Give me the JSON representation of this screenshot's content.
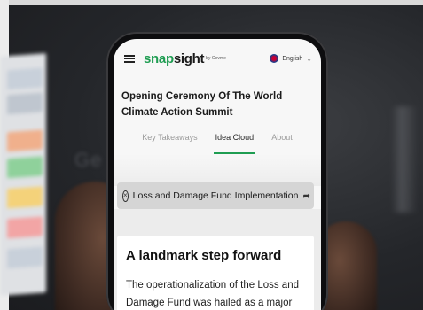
{
  "header": {
    "logo_primary": "snap",
    "logo_secondary": "sight",
    "logo_tag": "by Gevme",
    "language": "English",
    "icons": {
      "menu": "hamburger-icon",
      "flag": "flag-icon",
      "chevron": "chevron-down-icon"
    }
  },
  "session": {
    "title": "Opening Ceremony Of The World Climate Action Summit"
  },
  "tabs": [
    {
      "label": "Key Takeaways",
      "active": false
    },
    {
      "label": "Idea Cloud",
      "active": true
    },
    {
      "label": "About",
      "active": false
    }
  ],
  "chip": {
    "label": "Loss and Damage Fund Implementation",
    "close_icon": "close-circle-icon",
    "share_icon": "share-icon"
  },
  "article": {
    "heading": "A landmark step forward",
    "body_lines": [
      "The operationalization of the Loss and",
      "Damage Fund was hailed as a major"
    ]
  },
  "colors": {
    "brand_green": "#1f9d52",
    "active_tab_underline": "#1f9d52",
    "chip_bg": "#d5d5d5"
  }
}
